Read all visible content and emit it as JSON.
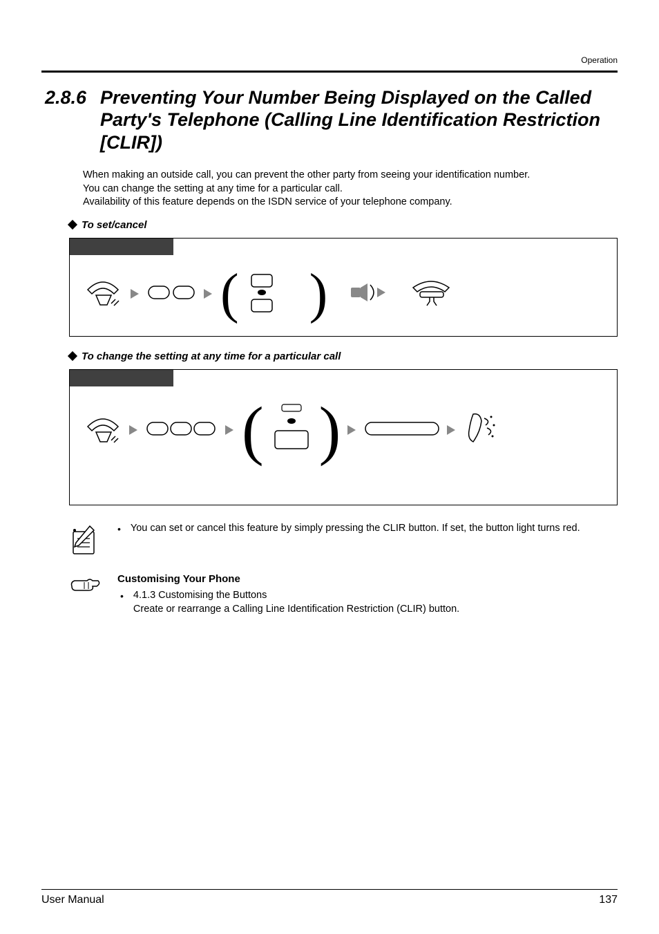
{
  "header": {
    "category": "Operation"
  },
  "section": {
    "number": "2.8.6",
    "title": "Preventing Your Number Being Displayed on the Called Party's Telephone (Calling Line Identification Restriction [CLIR])"
  },
  "intro": {
    "p1": "When making an outside call, you can prevent the other party from seeing your identification number.",
    "p2": "You can change the setting at any time for a particular call.",
    "p3": "Availability of this feature depends on the ISDN service of your telephone company."
  },
  "subheaders": {
    "a": "To set/cancel",
    "b": "To change the setting at any time for a particular call"
  },
  "notes": {
    "tip1": "You can set or cancel this feature by simply pressing the CLIR button. If set, the button light turns red.",
    "customisingTitle": "Customising Your Phone",
    "customisingRef": "4.1.3   Customising the Buttons",
    "customisingBody": "Create or rearrange a Calling Line Identification Restriction (CLIR) button."
  },
  "footer": {
    "left": "User Manual",
    "right": "137"
  }
}
